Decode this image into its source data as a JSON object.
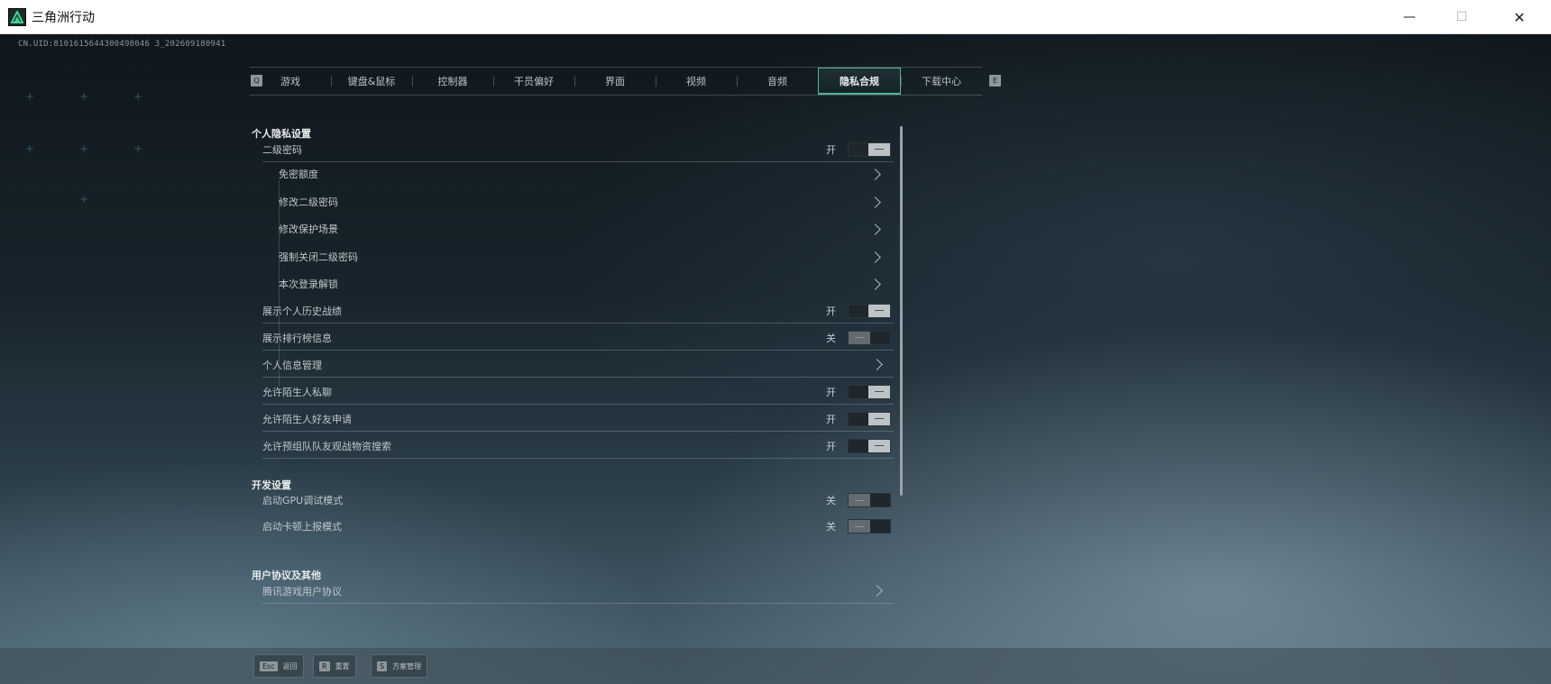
{
  "window": {
    "title": "三角洲行动",
    "minimize_glyph": "—",
    "maximize_glyph": "☐",
    "close_glyph": "✕"
  },
  "uid_text": "CN.UID:8101615644300498046 3_202609180941",
  "tabs": {
    "left_key": "Q",
    "right_key": "E",
    "items": [
      {
        "label": "游戏"
      },
      {
        "label": "键盘&鼠标"
      },
      {
        "label": "控制器"
      },
      {
        "label": "干员偏好"
      },
      {
        "label": "界面"
      },
      {
        "label": "视频"
      },
      {
        "label": "音频"
      },
      {
        "label": "隐私合规",
        "active": true
      },
      {
        "label": "下载中心"
      }
    ]
  },
  "sections": {
    "privacy": {
      "title": "个人隐私设置",
      "second_password": {
        "label": "二级密码",
        "state": "开"
      },
      "sub_items": [
        {
          "label": "免密额度"
        },
        {
          "label": "修改二级密码"
        },
        {
          "label": "修改保护场景"
        },
        {
          "label": "强制关闭二级密码"
        },
        {
          "label": "本次登录解锁"
        }
      ],
      "rows": [
        {
          "label": "展示个人历史战绩",
          "state": "开"
        },
        {
          "label": "展示排行榜信息",
          "state": "关"
        },
        {
          "label": "个人信息管理"
        },
        {
          "label": "允许陌生人私聊",
          "state": "开"
        },
        {
          "label": "允许陌生人好友申请",
          "state": "开"
        },
        {
          "label": "允许预组队队友观战物资搜索",
          "state": "开"
        }
      ]
    },
    "dev": {
      "title": "开发设置",
      "rows": [
        {
          "label": "启动GPU调试模式",
          "state": "关"
        },
        {
          "label": "启动卡顿上报模式",
          "state": "关"
        }
      ]
    },
    "agreements": {
      "title": "用户协议及其他",
      "rows": [
        {
          "label": "腾讯游戏用户协议"
        }
      ]
    }
  },
  "bottom_hints": [
    {
      "key": "Esc",
      "label": "返回"
    },
    {
      "key": "R",
      "label": "重置"
    },
    {
      "key": "S",
      "label": "方案管理"
    }
  ],
  "colors": {
    "accent": "#4fb39c",
    "toggle_on_knob": "#bcc3c6",
    "toggle_off_knob": "#616b70"
  }
}
